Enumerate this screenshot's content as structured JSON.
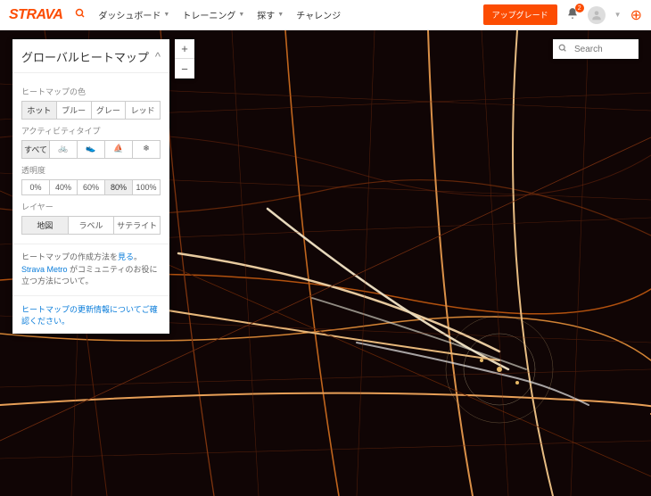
{
  "brand": "STRAVA",
  "nav": {
    "dashboard": "ダッシュボード",
    "training": "トレーニング",
    "explore": "探す",
    "challenge": "チャレンジ"
  },
  "upgrade": "アップグレード",
  "notif_count": "2",
  "panel": {
    "title": "グローバルヒートマップ",
    "collapse": "^",
    "color_label": "ヒートマップの色",
    "colors": {
      "hot": "ホット",
      "blue": "ブルー",
      "gray": "グレー",
      "red": "レッド"
    },
    "activity_label": "アクティビティタイプ",
    "activities": {
      "all": "すべて",
      "bike": "🚲",
      "run": "👟",
      "water": "⛵",
      "winter": "❄"
    },
    "opacity_label": "透明度",
    "opacity": {
      "o0": "0%",
      "o40": "40%",
      "o60": "60%",
      "o80": "80%",
      "o100": "100%"
    },
    "layer_label": "レイヤー",
    "layers": {
      "map": "地図",
      "label": "ラベル",
      "sat": "サテライト"
    },
    "footer_pre": "ヒートマップの作成方法を",
    "footer_link1": "見る",
    "footer_post": "。",
    "footer_line2a": "Strava Metro",
    "footer_line2b": " がコミュニティのお役に立つ方法について。",
    "update_link": "ヒートマップの更新情報についてご確認ください。"
  },
  "search": {
    "placeholder": "Search"
  },
  "zoom": {
    "in": "+",
    "out": "−"
  }
}
